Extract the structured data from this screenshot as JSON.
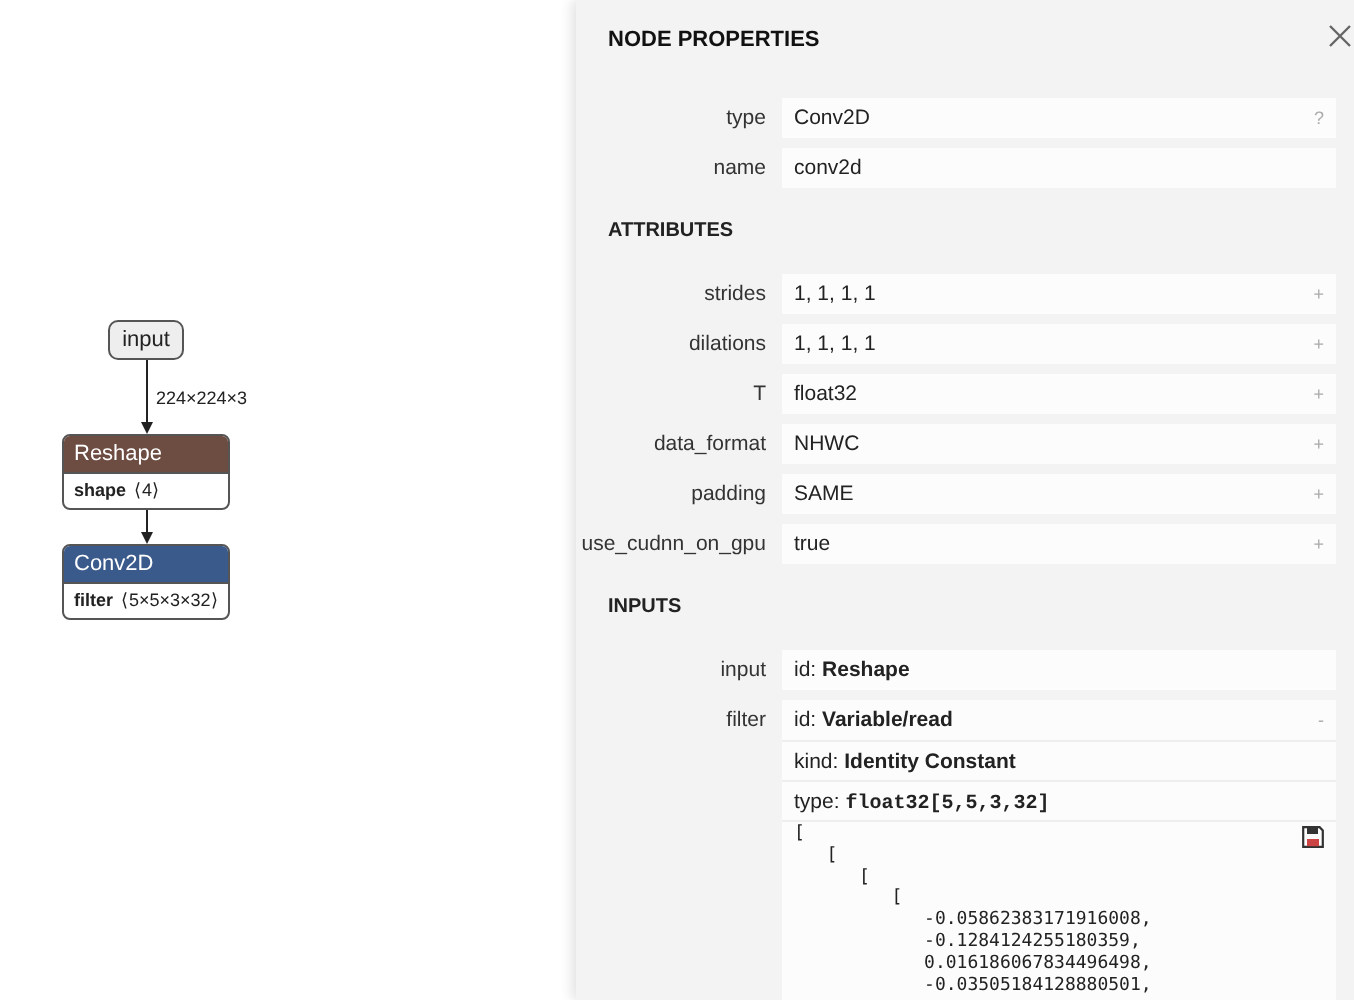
{
  "graph": {
    "nodes": [
      {
        "kind": "plain",
        "label": "input",
        "output_label": "224×224×3"
      },
      {
        "kind": "op",
        "label": "Reshape",
        "color": "#6d4c41",
        "attributes": [
          {
            "name": "shape",
            "value": "⟨4⟩"
          }
        ]
      },
      {
        "kind": "op",
        "label": "Conv2D",
        "color": "#3b5a8c",
        "attributes": [
          {
            "name": "filter",
            "value": "⟨5×5×3×32⟩"
          }
        ]
      }
    ]
  },
  "panel": {
    "title": "NODE PROPERTIES",
    "properties": [
      {
        "label": "type",
        "value": "Conv2D",
        "button": "?"
      },
      {
        "label": "name",
        "value": "conv2d"
      }
    ],
    "sections": [
      {
        "title": "ATTRIBUTES",
        "rows": [
          {
            "label": "strides",
            "lines": [
              {
                "kind": "plain",
                "text": "1, 1, 1, 1"
              }
            ],
            "button": "+"
          },
          {
            "label": "dilations",
            "lines": [
              {
                "kind": "plain",
                "text": "1, 1, 1, 1"
              }
            ],
            "button": "+"
          },
          {
            "label": "T",
            "lines": [
              {
                "kind": "plain",
                "text": "float32"
              }
            ],
            "button": "+"
          },
          {
            "label": "data_format",
            "lines": [
              {
                "kind": "plain",
                "text": "NHWC"
              }
            ],
            "button": "+"
          },
          {
            "label": "padding",
            "lines": [
              {
                "kind": "plain",
                "text": "SAME"
              }
            ],
            "button": "+"
          },
          {
            "label": "use_cudnn_on_gpu",
            "lines": [
              {
                "kind": "plain",
                "text": "true"
              }
            ],
            "button": "+"
          }
        ]
      },
      {
        "title": "INPUTS",
        "rows": [
          {
            "label": "input",
            "lines": [
              {
                "kind": "field",
                "key": "id:",
                "value": "Reshape"
              }
            ]
          },
          {
            "label": "filter",
            "button": "-",
            "lines": [
              {
                "kind": "field",
                "key": "id:",
                "value": "Variable/read"
              },
              {
                "kind": "field",
                "key": "kind:",
                "value": "Identity Constant"
              },
              {
                "kind": "mono",
                "key": "type:",
                "value": "float32[5,5,3,32]"
              },
              {
                "kind": "tensor",
                "text": "[\n   [\n      [\n         [\n            -0.05862383171916008,\n            -0.1284124255180359,\n            0.016186067834496498,\n            -0.03505184128880501,"
              }
            ]
          }
        ]
      }
    ]
  }
}
